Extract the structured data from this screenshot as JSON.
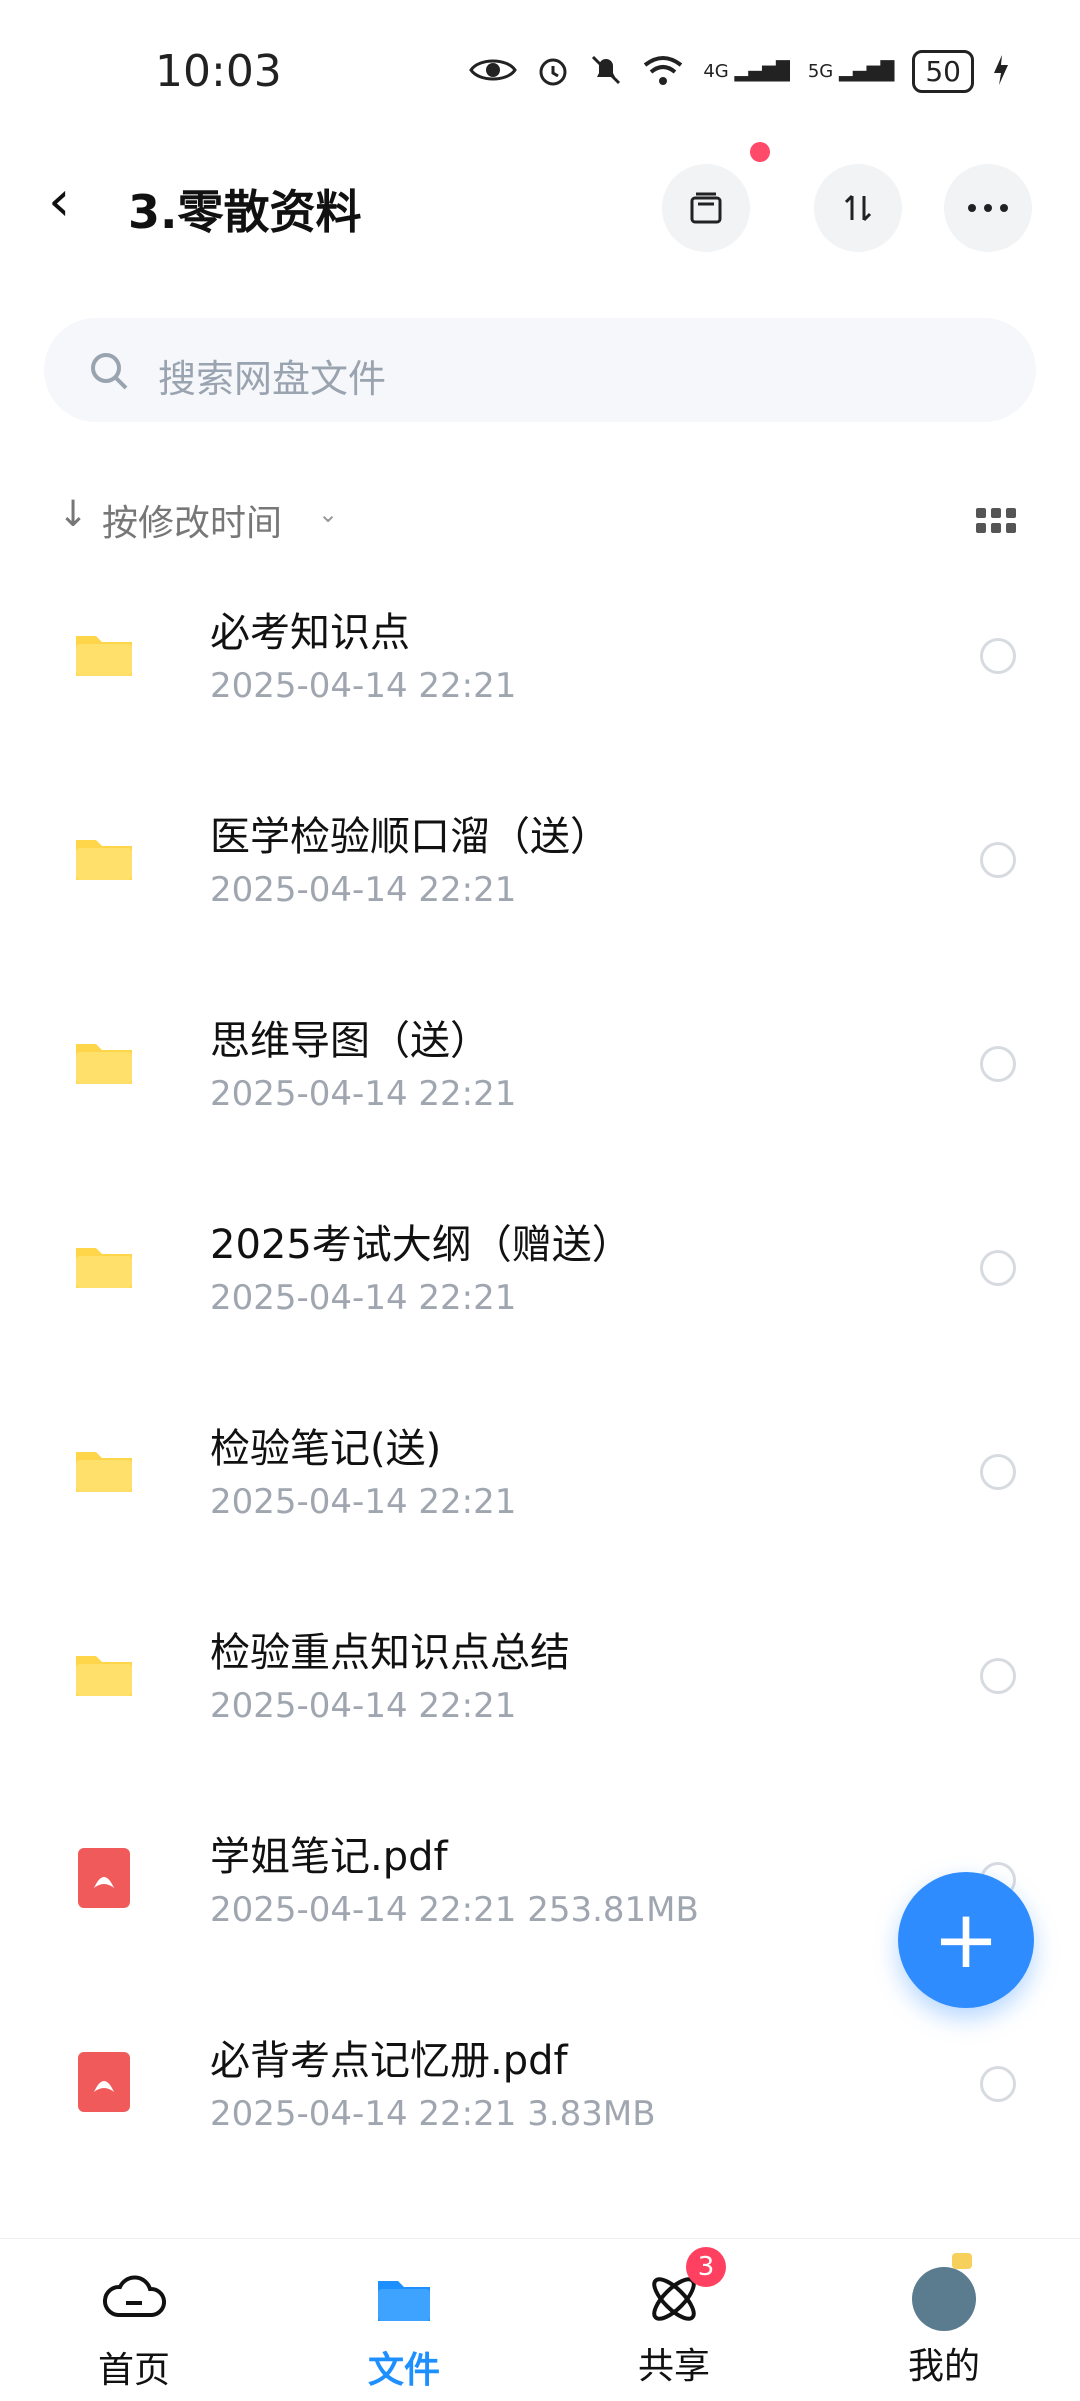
{
  "status_bar": {
    "time": "10:03",
    "network_1": "4G",
    "network_2": "5G",
    "battery": "50"
  },
  "header": {
    "back_icon": "chevron-left-icon",
    "title": "3.零散资料",
    "buttons": [
      "archive-icon",
      "sort-arrows-icon",
      "more-horizontal-icon"
    ],
    "notification_dot_color": "#ff4a6a"
  },
  "search": {
    "placeholder": "搜索网盘文件",
    "icon": "search-icon"
  },
  "sort": {
    "label": "按修改时间",
    "arrow": "↓",
    "caret": "⌄",
    "view_icon": "grid-view-icon"
  },
  "files": [
    {
      "name": "必考知识点",
      "date": "2025-04-14",
      "time": "22:21",
      "size": "",
      "type": "folder"
    },
    {
      "name": "医学检验顺口溜（送）",
      "date": "2025-04-14",
      "time": "22:21",
      "size": "",
      "type": "folder"
    },
    {
      "name": "思维导图（送）",
      "date": "2025-04-14",
      "time": "22:21",
      "size": "",
      "type": "folder"
    },
    {
      "name": "2025考试大纲（赠送）",
      "date": "2025-04-14",
      "time": "22:21",
      "size": "",
      "type": "folder"
    },
    {
      "name": "检验笔记(送)",
      "date": "2025-04-14",
      "time": "22:21",
      "size": "",
      "type": "folder"
    },
    {
      "name": "检验重点知识点总结",
      "date": "2025-04-14",
      "time": "22:21",
      "size": "",
      "type": "folder"
    },
    {
      "name": "学姐笔记.pdf",
      "date": "2025-04-14",
      "time": "22:21",
      "size": "253.81MB",
      "type": "pdf"
    },
    {
      "name": "必背考点记忆册.pdf",
      "date": "2025-04-14",
      "time": "22:21",
      "size": "3.83MB",
      "type": "pdf"
    }
  ],
  "fab": {
    "icon": "plus-icon",
    "symbol": "+"
  },
  "bottom_nav": {
    "items": [
      {
        "label": "首页",
        "icon": "cloud-icon",
        "active": false
      },
      {
        "label": "文件",
        "icon": "folder-icon",
        "active": true
      },
      {
        "label": "共享",
        "icon": "atom-icon",
        "badge": "3",
        "active": false
      },
      {
        "label": "我的",
        "icon": "avatar",
        "active": false
      }
    ]
  },
  "colors": {
    "accent": "#1e8fff",
    "folder": "#ffd54a",
    "pdf": "#f05a5a",
    "badge": "#ff4060"
  }
}
